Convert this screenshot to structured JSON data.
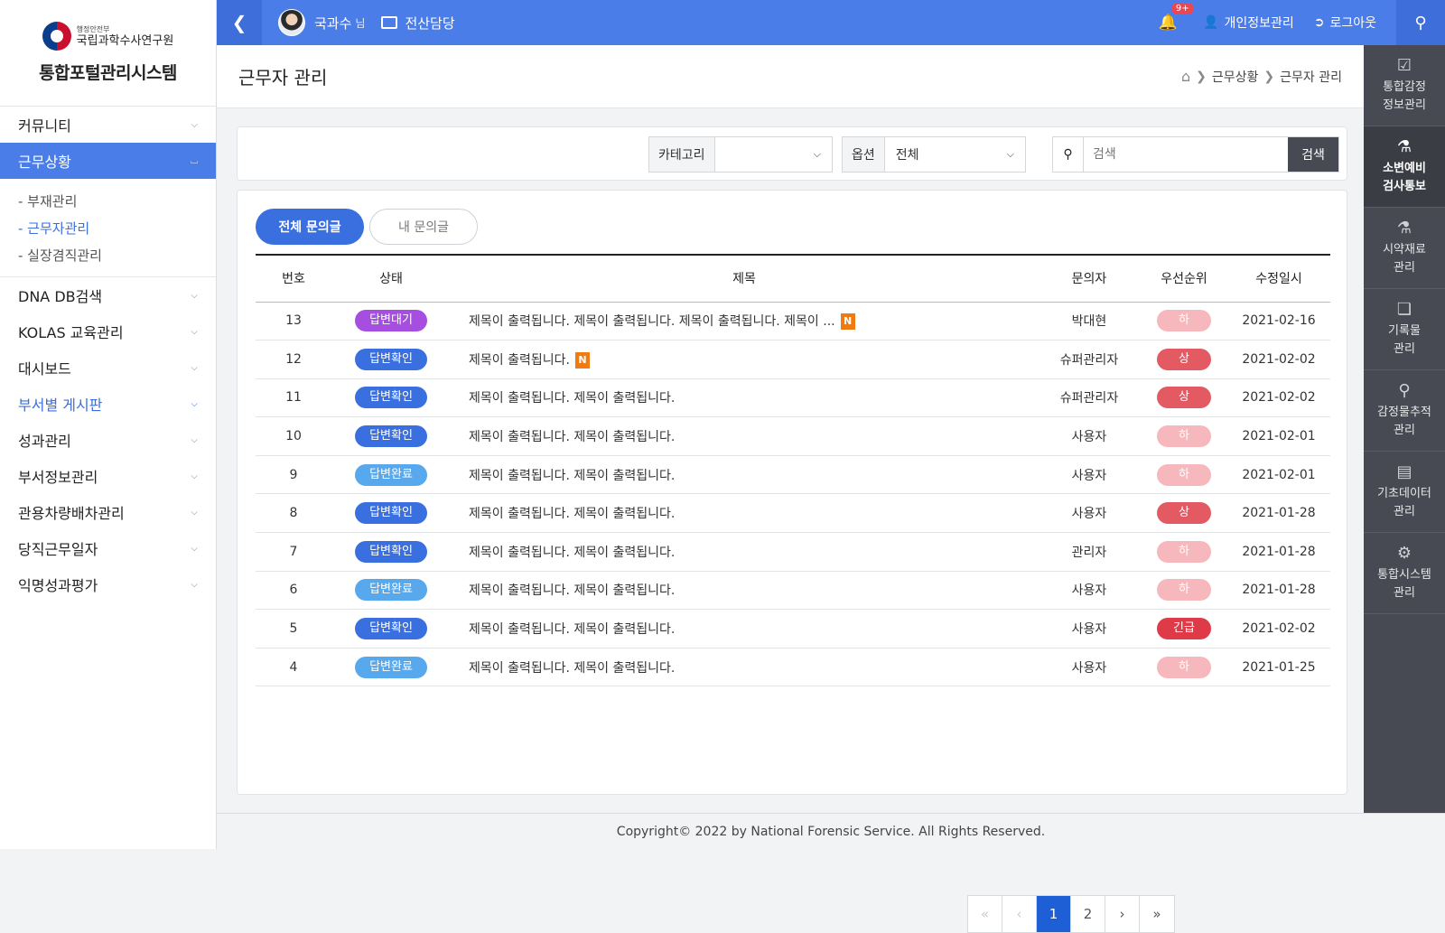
{
  "brand": {
    "small": "행정안전부",
    "org": "국립과학수사연구원",
    "title": "통합포털관리시스템"
  },
  "sidebar": {
    "items": [
      {
        "label": "커뮤니티"
      },
      {
        "label": "근무상황"
      },
      {
        "label": "DNA DB검색"
      },
      {
        "label": "KOLAS 교육관리"
      },
      {
        "label": "대시보드"
      },
      {
        "label": "부서별 게시판"
      },
      {
        "label": "성과관리"
      },
      {
        "label": "부서정보관리"
      },
      {
        "label": "관용차량배차관리"
      },
      {
        "label": "당직근무일자"
      },
      {
        "label": "익명성과평가"
      }
    ],
    "submenu": [
      "- 부재관리",
      "- 근무자관리",
      "- 실장겸직관리"
    ]
  },
  "topbar": {
    "user": "국과수",
    "suffix": "님",
    "dept": "전산담당",
    "badge": "9+",
    "privacy": "개인정보관리",
    "logout": "로그아웃"
  },
  "rightbar": [
    {
      "icon": "clipboard-check-icon",
      "l1": "통합감정",
      "l2": "정보관리"
    },
    {
      "icon": "flask-icon",
      "l1": "소변예비",
      "l2": "검사통보"
    },
    {
      "icon": "flask-icon",
      "l1": "시약재료",
      "l2": "관리"
    },
    {
      "icon": "files-icon",
      "l1": "기록물",
      "l2": "관리"
    },
    {
      "icon": "search-icon",
      "l1": "감정물추적",
      "l2": "관리"
    },
    {
      "icon": "clipboard-icon",
      "l1": "기초데이터",
      "l2": "관리"
    },
    {
      "icon": "gear-icon",
      "l1": "통합시스템",
      "l2": "관리"
    }
  ],
  "page": {
    "title": "근무자 관리",
    "crumb1": "근무상황",
    "crumb2": "근무자 관리"
  },
  "filter": {
    "category_label": "카테고리",
    "category_value": "",
    "option_label": "옵션",
    "option_value": "전체",
    "search_placeholder": "검색",
    "search_button": "검색"
  },
  "tabs": {
    "all": "전체 문의글",
    "mine": "내 문의글"
  },
  "table": {
    "headers": [
      "번호",
      "상태",
      "제목",
      "문의자",
      "우선순위",
      "수정일시"
    ],
    "rows": [
      {
        "no": "13",
        "status": "답변대기",
        "title": "제목이 출력됩니다. 제목이 출력됩니다. 제목이 출력됩니다. 제목이 ...",
        "new": "N",
        "author": "박대현",
        "priority": "하",
        "date": "2021-02-16"
      },
      {
        "no": "12",
        "status": "답변확인",
        "title": "제목이 출력됩니다.",
        "new": "N",
        "author": "슈퍼관리자",
        "priority": "상",
        "date": "2021-02-02"
      },
      {
        "no": "11",
        "status": "답변확인",
        "title": "제목이 출력됩니다. 제목이 출력됩니다.",
        "new": "",
        "author": "슈퍼관리자",
        "priority": "상",
        "date": "2021-02-02"
      },
      {
        "no": "10",
        "status": "답변확인",
        "title": "제목이 출력됩니다. 제목이 출력됩니다.",
        "new": "",
        "author": "사용자",
        "priority": "하",
        "date": "2021-02-01"
      },
      {
        "no": "9",
        "status": "답변완료",
        "title": "제목이 출력됩니다. 제목이 출력됩니다.",
        "new": "",
        "author": "사용자",
        "priority": "하",
        "date": "2021-02-01"
      },
      {
        "no": "8",
        "status": "답변확인",
        "title": "제목이 출력됩니다. 제목이 출력됩니다.",
        "new": "",
        "author": "사용자",
        "priority": "상",
        "date": "2021-01-28"
      },
      {
        "no": "7",
        "status": "답변확인",
        "title": "제목이 출력됩니다. 제목이 출력됩니다.",
        "new": "",
        "author": "관리자",
        "priority": "하",
        "date": "2021-01-28"
      },
      {
        "no": "6",
        "status": "답변완료",
        "title": "제목이 출력됩니다. 제목이 출력됩니다.",
        "new": "",
        "author": "사용자",
        "priority": "하",
        "date": "2021-01-28"
      },
      {
        "no": "5",
        "status": "답변확인",
        "title": "제목이 출력됩니다. 제목이 출력됩니다.",
        "new": "",
        "author": "사용자",
        "priority": "긴급",
        "date": "2021-02-02"
      },
      {
        "no": "4",
        "status": "답변완료",
        "title": "제목이 출력됩니다. 제목이 출력됩니다.",
        "new": "",
        "author": "사용자",
        "priority": "하",
        "date": "2021-01-25"
      }
    ]
  },
  "pagination": {
    "first": "«",
    "prev": "‹",
    "pages": [
      "1",
      "2"
    ],
    "next": "›",
    "last": "»"
  },
  "footer": "Copyright© 2022 by National Forensic Service. All Rights Reserved.",
  "colors": {
    "primary": "#4a7de8",
    "dark_panel": "#474a52",
    "status_wait": "#a64ee0",
    "status_check": "#3a6fdf",
    "status_done": "#57a8ec",
    "priority_low": "#f6b8bc",
    "priority_high": "#e35a63",
    "new_badge": "#f07b12"
  }
}
